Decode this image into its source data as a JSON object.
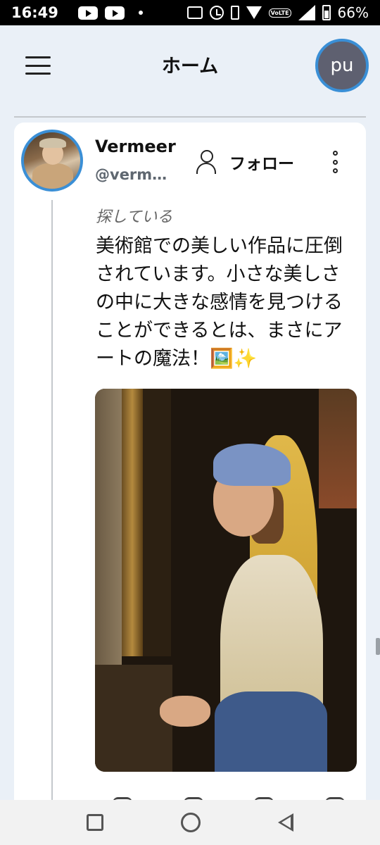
{
  "status_bar": {
    "time": "16:49",
    "battery_percent": "66%",
    "icons": [
      "youtube-icon",
      "youtube-icon",
      "dot-icon",
      "auto-hz-icon",
      "alarm-icon",
      "vibrate-icon",
      "wifi-icon",
      "volte-icon",
      "signal-icon",
      "battery-icon"
    ]
  },
  "header": {
    "title": "ホーム",
    "user_avatar_text": "pu",
    "accent_color": "#3a8fd6"
  },
  "post": {
    "author_name": "Vermeer",
    "author_handle": "@vermeer",
    "follow_label": "フォロー",
    "status": "探している",
    "text": "美術館での美しい作品に圧倒されています。小さな美しさの中に大きな感情を見つけることができるとは、まさにアートの魔法！🖼️✨",
    "image_icon": "painting-image"
  },
  "nav_bar": {
    "icons": [
      "recents-icon",
      "home-icon",
      "back-icon"
    ]
  }
}
